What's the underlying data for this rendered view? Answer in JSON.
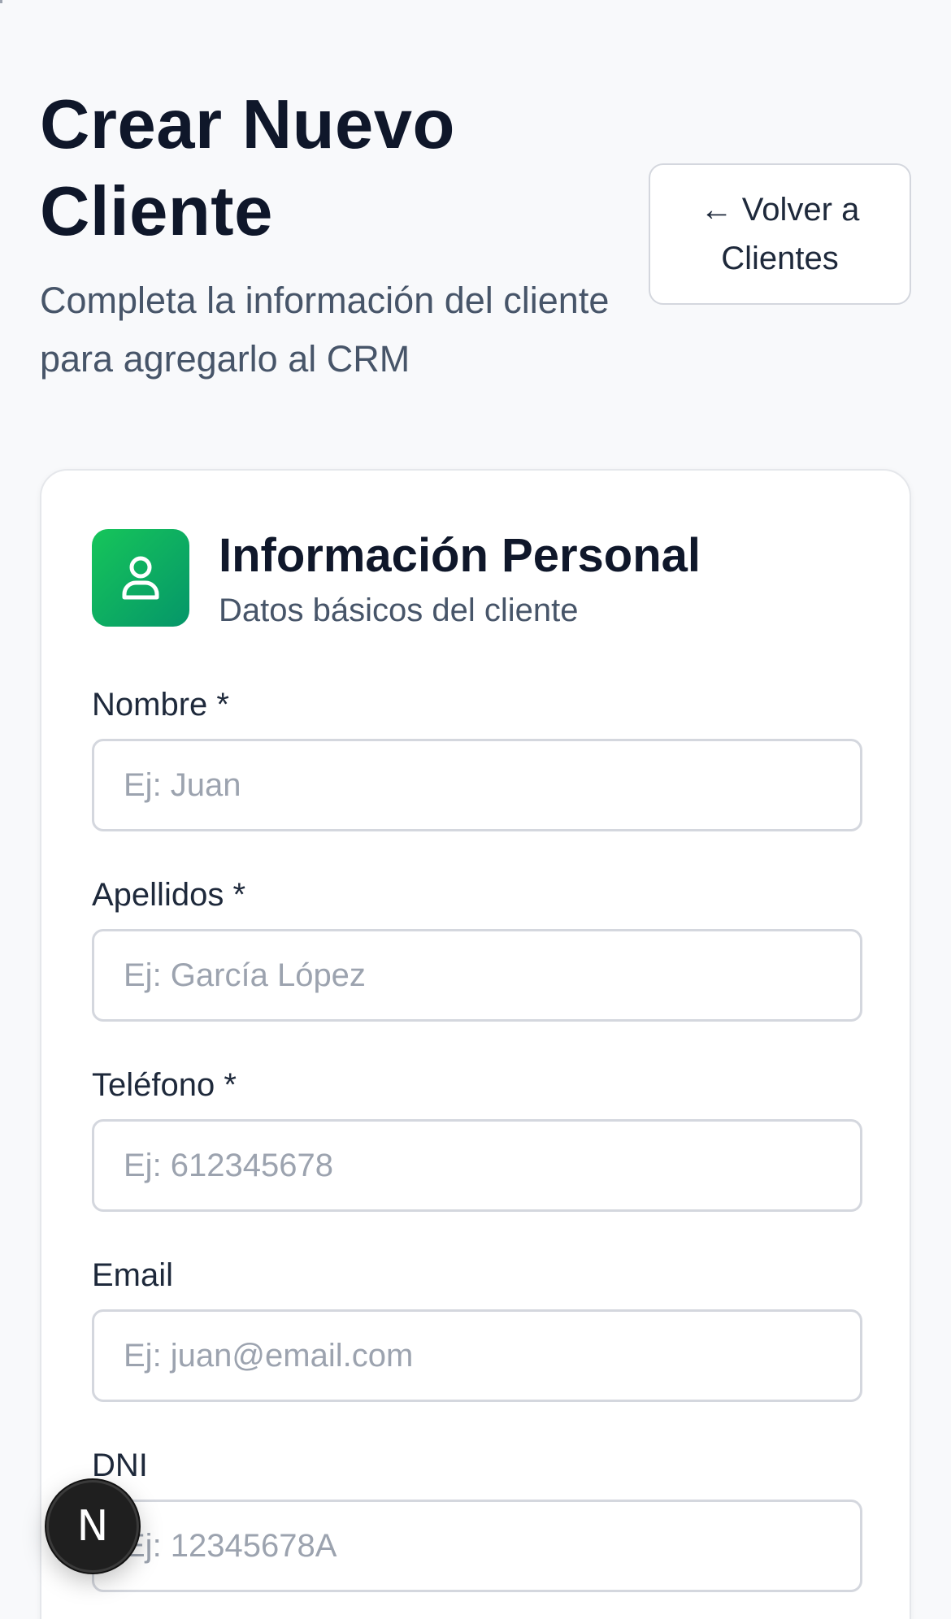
{
  "header": {
    "title": "Crear Nuevo Cliente",
    "subtitle": "Completa la información del cliente para agregarlo al CRM",
    "back_button_label": "← Volver a Clientes"
  },
  "section": {
    "icon": "user-icon",
    "title": "Información Personal",
    "subtitle": "Datos básicos del cliente",
    "icon_gradient": [
      "#16c55a",
      "#059669"
    ]
  },
  "fields": [
    {
      "label": "Nombre *",
      "placeholder": "Ej: Juan",
      "value": ""
    },
    {
      "label": "Apellidos *",
      "placeholder": "Ej: García López",
      "value": ""
    },
    {
      "label": "Teléfono *",
      "placeholder": "Ej: 612345678",
      "value": ""
    },
    {
      "label": "Email",
      "placeholder": "Ej: juan@email.com",
      "value": ""
    },
    {
      "label": "DNI",
      "placeholder": "Ej: 12345678A",
      "value": ""
    }
  ],
  "dev_badge": {
    "letter": "N",
    "icon": "nextjs-icon"
  },
  "colors": {
    "background": "#f8f9fb",
    "text_primary": "#0f172a",
    "text_secondary": "#475569",
    "accent": "#16c55a"
  }
}
